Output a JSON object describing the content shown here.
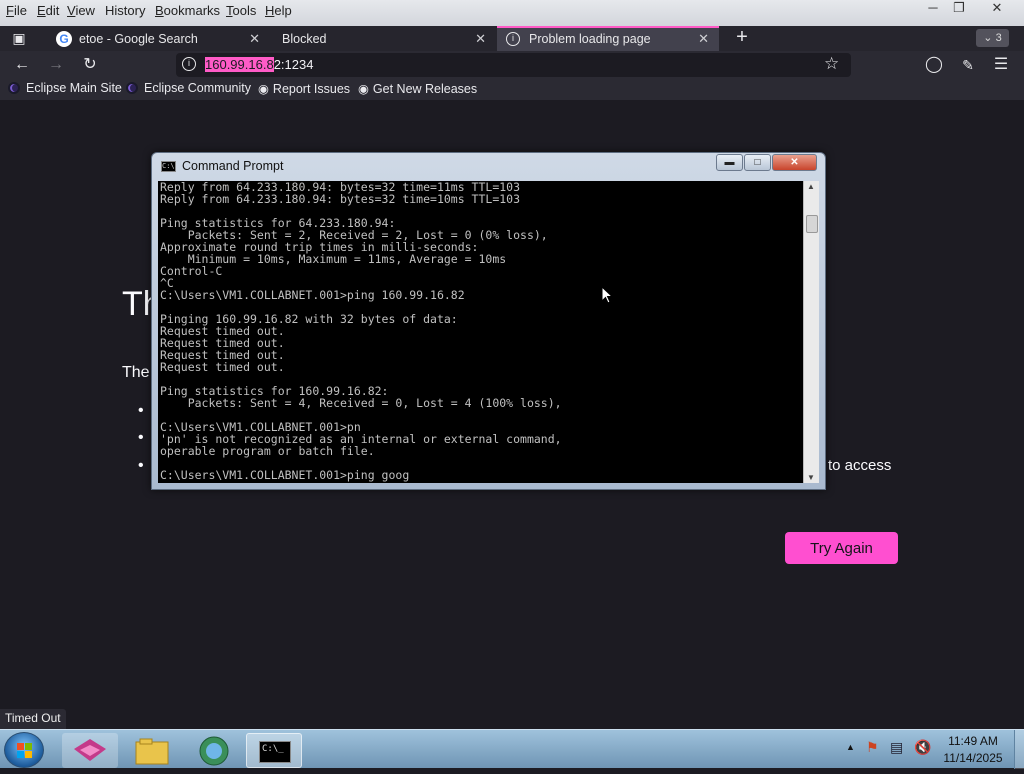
{
  "menubar": {
    "items": [
      {
        "label": "File",
        "accel": "F",
        "rest": "ile"
      },
      {
        "label": "Edit",
        "accel": "E",
        "rest": "dit"
      },
      {
        "label": "View",
        "accel": "V",
        "rest": "iew"
      },
      {
        "label": "History",
        "accel": "",
        "rest": "History"
      },
      {
        "label": "Bookmarks",
        "accel": "B",
        "rest": "ookmarks"
      },
      {
        "label": "Tools",
        "accel": "T",
        "rest": "ools"
      },
      {
        "label": "Help",
        "accel": "H",
        "rest": "elp"
      }
    ]
  },
  "tabs": {
    "tab1": "etoe - Google Search",
    "tab2": "Blocked",
    "tab3": "Problem loading page",
    "overflow_count": "3"
  },
  "navbar": {
    "url_highlight": "160.99.16.8",
    "url_rest": "2:1234"
  },
  "bookmarks": {
    "items": [
      "Eclipse Main Site",
      "Eclipse Community",
      "Report Issues",
      "Get New Releases"
    ]
  },
  "page": {
    "title_partial": "Th",
    "text_partial": "The",
    "access_text": "to access",
    "try_again": "Try Again"
  },
  "cmd": {
    "title": "Command Prompt",
    "icon_text": "C:\\",
    "lines": [
      "Reply from 64.233.180.94: bytes=32 time=11ms TTL=103",
      "Reply from 64.233.180.94: bytes=32 time=10ms TTL=103",
      "",
      "Ping statistics for 64.233.180.94:",
      "    Packets: Sent = 2, Received = 2, Lost = 0 (0% loss),",
      "Approximate round trip times in milli-seconds:",
      "    Minimum = 10ms, Maximum = 11ms, Average = 10ms",
      "Control-C",
      "^C",
      "C:\\Users\\VM1.COLLABNET.001>ping 160.99.16.82",
      "",
      "Pinging 160.99.16.82 with 32 bytes of data:",
      "Request timed out.",
      "Request timed out.",
      "Request timed out.",
      "Request timed out.",
      "",
      "Ping statistics for 160.99.16.82:",
      "    Packets: Sent = 4, Received = 0, Lost = 4 (100% loss),",
      "",
      "C:\\Users\\VM1.COLLABNET.001>pn",
      "'pn' is not recognized as an internal or external command,",
      "operable program or batch file.",
      "",
      "C:\\Users\\VM1.COLLABNET.001>ping goog"
    ]
  },
  "status": {
    "text": "Timed Out"
  },
  "taskbar": {
    "time": "11:49 AM",
    "date": "11/14/2025",
    "cmd_icon_text": "C:\\_"
  }
}
